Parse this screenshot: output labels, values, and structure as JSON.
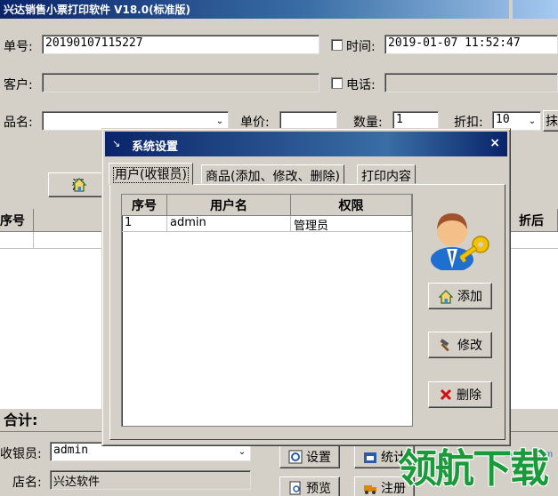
{
  "window": {
    "title": "兴达销售小票打印软件 V18.0(标准版)"
  },
  "form": {
    "order_no_label": "单号:",
    "order_no": "20190107115227",
    "time_label": "时间:",
    "time": "2019-01-07 11:52:47",
    "customer_label": "客户:",
    "customer": "",
    "phone_label": "电话:",
    "phone": "",
    "product_label": "品名:",
    "product": "",
    "price_label": "单价:",
    "price": "",
    "qty_label": "数量:",
    "qty": "1",
    "discount_label": "折扣:",
    "discount": "10",
    "erase_partial": "抹",
    "add_partial": "添"
  },
  "main_grid": {
    "col_no": "序号",
    "col_after_discount": "折后"
  },
  "footer": {
    "total_label": "合计:",
    "cashier_label": "收银员:",
    "cashier": "admin",
    "store_label": "店名:",
    "store": "兴达软件",
    "settings_button": "设置",
    "stats_button": "统计",
    "preview_button": "预览",
    "register_button": "注册"
  },
  "dialog": {
    "title": "系统设置",
    "close": "×",
    "tabs": [
      "用户(收银员)",
      "商品(添加、修改、删除)",
      "打印内容"
    ],
    "columns": [
      "序号",
      "用户名",
      "权限"
    ],
    "rows": [
      {
        "no": "1",
        "username": "admin",
        "role": "管理员"
      }
    ],
    "add_button": "添加",
    "edit_button": "修改",
    "delete_button": "删除"
  },
  "watermark": {
    "text": "领航下载",
    "url": "lhdown.com"
  }
}
